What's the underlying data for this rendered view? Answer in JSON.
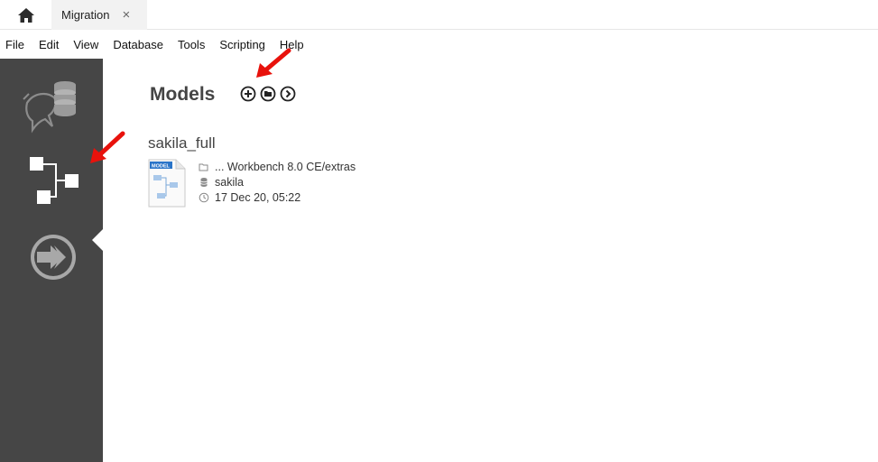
{
  "tabs": {
    "home_icon": "home-icon",
    "active_tab_label": "Migration",
    "close_glyph": "×"
  },
  "menu": {
    "items": [
      "File",
      "Edit",
      "View",
      "Database",
      "Tools",
      "Scripting",
      "Help"
    ]
  },
  "sidebar": {
    "items": [
      {
        "name": "connections",
        "icon": "dolphin-database-icon"
      },
      {
        "name": "models",
        "icon": "model-diagram-icon",
        "active": true
      },
      {
        "name": "migration",
        "icon": "migration-arrow-icon"
      }
    ]
  },
  "models": {
    "title": "Models",
    "actions": [
      {
        "name": "add-model",
        "icon": "plus-circle-icon"
      },
      {
        "name": "open-model",
        "icon": "folder-circle-icon"
      },
      {
        "name": "more-models",
        "icon": "chevron-right-circle-icon"
      }
    ],
    "items": [
      {
        "name": "sakila_full",
        "thumb_label": "MODEL",
        "path": "... Workbench 8.0 CE/extras",
        "schema": "sakila",
        "modified": "17 Dec 20, 05:22"
      }
    ]
  },
  "colors": {
    "sidebar_bg": "#464646",
    "sidebar_icon": "#ffffff",
    "annotation_arrow": "#e8120c"
  }
}
